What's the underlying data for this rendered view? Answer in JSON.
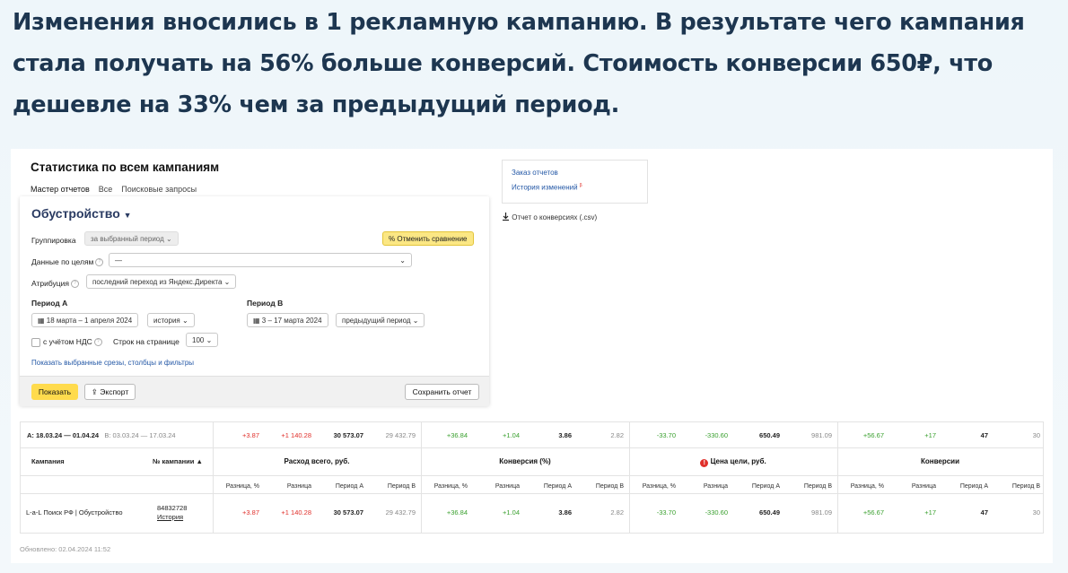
{
  "headline": "Изменения вносились в 1 рекламную кампанию. В результате чего кампания стала получать на 56% больше конверсий. Стоимость конверсии 650₽, что дешевле на 33% чем за предыдущий период.",
  "page_title": "Статистика по всем кампаниям",
  "tabs": [
    "Мастер отчетов",
    "Все",
    "Поисковые запросы"
  ],
  "side_links": {
    "order": "Заказ отчетов",
    "history": "История изменений",
    "history_sup": "β"
  },
  "export_csv": "Отчет о конверсиях (.csv)",
  "report": {
    "name": "Обустройство",
    "grouping_label": "Группировка",
    "grouping_value": "за выбранный период",
    "cancel_compare": "Отменить сравнение",
    "goals_label": "Данные по целям",
    "goals_value": "—",
    "attribution_label": "Атрибуция",
    "attribution_value": "последний переход из Яндекс.Директа",
    "period_a_label": "Период А",
    "period_a_value": "18 марта – 1 апреля 2024",
    "period_a_mode": "история",
    "period_b_label": "Период В",
    "period_b_value": "3 – 17 марта 2024",
    "period_b_mode": "предыдущий период",
    "vat_label": "с учётом НДС",
    "rows_label": "Строк на странице",
    "rows_value": "100",
    "show_slices": "Показать выбранные срезы, столбцы и фильтры",
    "show_btn": "Показать",
    "export_btn": "Экспорт",
    "save_btn": "Сохранить отчет"
  },
  "table": {
    "period_a_tag": "А:",
    "period_a": "18.03.24 — 01.04.24",
    "period_b_tag": "В:",
    "period_b": "03.03.24 — 17.03.24",
    "col_campaign": "Кампания",
    "col_campaign_no": "№ кампании ▲",
    "groups": [
      "Расход всего, руб.",
      "Конверсия (%)",
      "Цена цели, руб.",
      "Конверсии"
    ],
    "subheaders": [
      "Разница, %",
      "Разница",
      "Период А",
      "Период В"
    ],
    "totals": [
      [
        "+3.87",
        "+1 140.28",
        "30 573.07",
        "29 432.79"
      ],
      [
        "+36.84",
        "+1.04",
        "3.86",
        "2.82"
      ],
      [
        "-33.70",
        "-330.60",
        "650.49",
        "981.09"
      ],
      [
        "+56.67",
        "+17",
        "47",
        "30"
      ]
    ],
    "row": {
      "campaign": "L-a-L Поиск РФ | Обустройство",
      "campaign_id": "84832728",
      "history": "История",
      "values": [
        [
          "+3.87",
          "+1 140.28",
          "30 573.07",
          "29 432.79"
        ],
        [
          "+36.84",
          "+1.04",
          "3.86",
          "2.82"
        ],
        [
          "-33.70",
          "-330.60",
          "650.49",
          "981.09"
        ],
        [
          "+56.67",
          "+17",
          "47",
          "30"
        ]
      ]
    }
  },
  "updated": "Обновлено: 02.04.2024 11:52",
  "colors": {
    "positive": "#3aa02f",
    "negative": "#e0302b",
    "accent": "#ffdb4d"
  }
}
